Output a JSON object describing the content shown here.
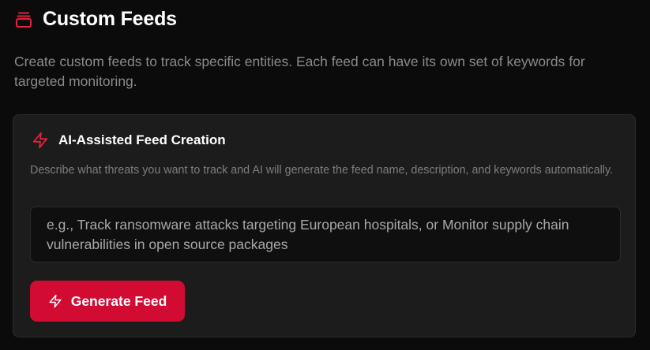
{
  "header": {
    "title": "Custom Feeds",
    "icon": "archive-box-icon"
  },
  "subtitle": "Create custom feeds to track specific entities. Each feed can have its own set of keywords for targeted monitoring.",
  "ai_card": {
    "icon": "lightning-bolt-icon",
    "title": "AI-Assisted Feed Creation",
    "description": "Describe what threats you want to track and AI will generate the feed name, description, and keywords automatically.",
    "input": {
      "value": "",
      "placeholder": "e.g., Track ransomware attacks targeting European hospitals, or Monitor supply chain vulnerabilities in open source packages"
    },
    "button": {
      "icon": "lightning-bolt-icon",
      "label": "Generate Feed"
    }
  },
  "colors": {
    "accent": "#d20b32",
    "background": "#0b0b0b",
    "card": "#1c1c1c"
  }
}
